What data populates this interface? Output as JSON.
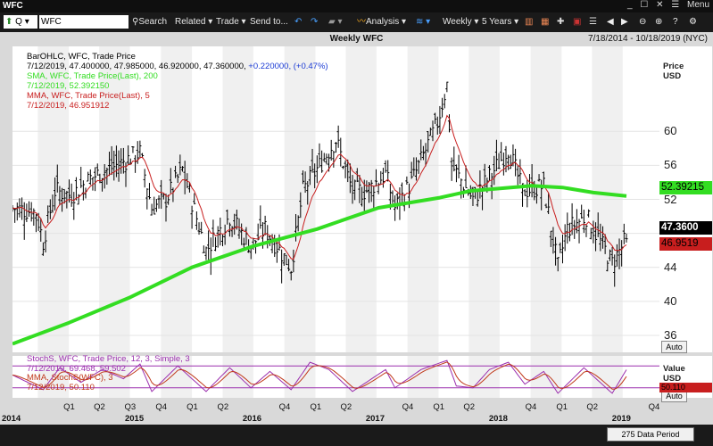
{
  "window": {
    "title": "WFC",
    "controls": [
      "_",
      "☐",
      "✕"
    ],
    "menu_label": "Menu"
  },
  "toolbar": {
    "symbol_prefix": "Q",
    "symbol_value": "WFC",
    "search_label": "Search",
    "related_label": "Related",
    "trade_label": "Trade",
    "sendto_label": "Send to...",
    "analysis_label": "Analysis",
    "weekly_label": "Weekly",
    "years_label": "5 Years"
  },
  "header": {
    "title": "Weekly WFC",
    "date_range": "7/18/2014 - 10/18/2019 (NYC)"
  },
  "legend_main": [
    {
      "text": "BarOHLC, WFC, Trade Price",
      "color": "#000000"
    },
    {
      "text": "7/12/2019, 47.400000, 47.985000, 46.920000, 47.360000, +0.220000, (+0.47%)",
      "color": "#000000",
      "extra": "+0.220000, (+0.47%)",
      "extra_color": "#1a3ad4"
    },
    {
      "text": "SMA, WFC, Trade Price(Last), 200",
      "color": "#33dd22"
    },
    {
      "text": "7/12/2019, 52.392150",
      "color": "#33dd22"
    },
    {
      "text": "MMA, WFC, Trade Price(Last), 5",
      "color": "#c81e1e"
    },
    {
      "text": "7/12/2019, 46.951912",
      "color": "#c81e1e"
    }
  ],
  "legend_stoch": [
    {
      "text": "StochS, WFC, Trade Price, 12, 3, Simple, 3",
      "color": "#9b2fae"
    },
    {
      "text": "7/12/2019, 69.468, 59.502",
      "color": "#9b2fae"
    },
    {
      "text": "MMA, StochS(WFC), 3",
      "color": "#c0391b"
    },
    {
      "text": "7/12/2019, 50.110",
      "color": "#c0391b"
    }
  ],
  "price_axis": {
    "title_line1": "Price",
    "title_line2": "USD",
    "auto_label": "Auto"
  },
  "value_axis": {
    "title_line1": "Value",
    "title_line2": "USD",
    "auto_label": "Auto"
  },
  "price_boxes": {
    "sma": "52.39215",
    "last": "47.3600",
    "mma": "46.9519",
    "stoch": "50.110"
  },
  "colors": {
    "sma": "#33dd22",
    "mma": "#c81e1e",
    "bars": "#000000",
    "stoch": "#9b2fae",
    "stoch_mma": "#c0391b"
  },
  "chart_data": {
    "type": "line",
    "title": "Weekly WFC",
    "x_range": [
      "2014-07-18",
      "2019-10-18"
    ],
    "ylim": [
      34,
      70
    ],
    "y_ticks": [
      36,
      40,
      44,
      48,
      52,
      56,
      60
    ],
    "y_tick_labels": [
      "36",
      "40",
      "44",
      "48",
      "52",
      "56",
      "60"
    ],
    "x_labels": [
      {
        "label": "2014",
        "d": "2014-07-18"
      },
      {
        "label": "Q1",
        "d": "2015-01-01"
      },
      {
        "label": "Q2",
        "d": "2015-04-01"
      },
      {
        "label": "Q3",
        "d": "2015-07-01"
      },
      {
        "label": "2015",
        "d": "2015-07-18"
      },
      {
        "label": "Q4",
        "d": "2015-10-01"
      },
      {
        "label": "Q1",
        "d": "2016-01-01"
      },
      {
        "label": "Q2",
        "d": "2016-04-01"
      },
      {
        "label": "2016",
        "d": "2016-07-01"
      },
      {
        "label": "Q4",
        "d": "2016-10-01"
      },
      {
        "label": "Q1",
        "d": "2017-01-01"
      },
      {
        "label": "Q2",
        "d": "2017-04-01"
      },
      {
        "label": "2017",
        "d": "2017-07-01"
      },
      {
        "label": "Q4",
        "d": "2017-10-01"
      },
      {
        "label": "Q1",
        "d": "2018-01-01"
      },
      {
        "label": "Q2",
        "d": "2018-04-01"
      },
      {
        "label": "2018",
        "d": "2018-07-01"
      },
      {
        "label": "Q4",
        "d": "2018-10-01"
      },
      {
        "label": "Q1",
        "d": "2019-01-01"
      },
      {
        "label": "Q2",
        "d": "2019-04-01"
      },
      {
        "label": "2019",
        "d": "2019-07-01"
      },
      {
        "label": "Q4",
        "d": "2019-10-01"
      }
    ],
    "close_keypoints": [
      {
        "d": "2014-07-18",
        "v": 51
      },
      {
        "d": "2014-09-26",
        "v": 50.5
      },
      {
        "d": "2014-10-17",
        "v": 47
      },
      {
        "d": "2014-11-21",
        "v": 53
      },
      {
        "d": "2015-01-09",
        "v": 52.5
      },
      {
        "d": "2015-03-06",
        "v": 54.5
      },
      {
        "d": "2015-05-22",
        "v": 56
      },
      {
        "d": "2015-07-31",
        "v": 57.5
      },
      {
        "d": "2015-09-04",
        "v": 51
      },
      {
        "d": "2015-10-16",
        "v": 52
      },
      {
        "d": "2015-12-04",
        "v": 55.5
      },
      {
        "d": "2016-02-12",
        "v": 46
      },
      {
        "d": "2016-04-22",
        "v": 50
      },
      {
        "d": "2016-06-24",
        "v": 46.5
      },
      {
        "d": "2016-08-05",
        "v": 48.5
      },
      {
        "d": "2016-10-21",
        "v": 44
      },
      {
        "d": "2016-11-25",
        "v": 53
      },
      {
        "d": "2017-03-03",
        "v": 59
      },
      {
        "d": "2017-04-21",
        "v": 53
      },
      {
        "d": "2017-06-02",
        "v": 53
      },
      {
        "d": "2017-07-28",
        "v": 55
      },
      {
        "d": "2017-08-25",
        "v": 51
      },
      {
        "d": "2017-10-13",
        "v": 54
      },
      {
        "d": "2017-12-29",
        "v": 61
      },
      {
        "d": "2018-01-26",
        "v": 65.5
      },
      {
        "d": "2018-02-09",
        "v": 56
      },
      {
        "d": "2018-04-13",
        "v": 52
      },
      {
        "d": "2018-06-08",
        "v": 55
      },
      {
        "d": "2018-07-27",
        "v": 58
      },
      {
        "d": "2018-09-07",
        "v": 53
      },
      {
        "d": "2018-11-09",
        "v": 53.5
      },
      {
        "d": "2018-12-21",
        "v": 44
      },
      {
        "d": "2019-01-18",
        "v": 48.5
      },
      {
        "d": "2019-03-15",
        "v": 50
      },
      {
        "d": "2019-05-31",
        "v": 44.5
      },
      {
        "d": "2019-07-12",
        "v": 47.36
      }
    ],
    "sma200": [
      {
        "d": "2014-07-18",
        "v": 35
      },
      {
        "d": "2015-01-02",
        "v": 37.5
      },
      {
        "d": "2015-07-03",
        "v": 40.5
      },
      {
        "d": "2016-01-01",
        "v": 44
      },
      {
        "d": "2016-07-01",
        "v": 46.5
      },
      {
        "d": "2017-01-06",
        "v": 48.5
      },
      {
        "d": "2017-07-07",
        "v": 51
      },
      {
        "d": "2018-01-05",
        "v": 52.2
      },
      {
        "d": "2018-04-06",
        "v": 53
      },
      {
        "d": "2018-10-05",
        "v": 53.6
      },
      {
        "d": "2019-01-04",
        "v": 53.4
      },
      {
        "d": "2019-04-05",
        "v": 52.8
      },
      {
        "d": "2019-07-12",
        "v": 52.39
      }
    ],
    "last": {
      "open": 47.4,
      "high": 47.985,
      "low": 46.92,
      "close": 47.36,
      "change": 0.22,
      "change_pct": 0.47
    },
    "sma_last": 52.39215,
    "mma_last": 46.951912
  },
  "stoch_data": {
    "ylim": [
      0,
      100
    ],
    "bands": [
      80,
      20
    ],
    "stoch_last": 69.468,
    "signal_last": 59.502,
    "mma_last": 50.11,
    "curve_keypoints": [
      {
        "d": "2014-07-18",
        "v": 55
      },
      {
        "d": "2014-10-17",
        "v": 15
      },
      {
        "d": "2014-12-05",
        "v": 75
      },
      {
        "d": "2015-02-06",
        "v": 35
      },
      {
        "d": "2015-04-10",
        "v": 70
      },
      {
        "d": "2015-06-12",
        "v": 45
      },
      {
        "d": "2015-07-31",
        "v": 85
      },
      {
        "d": "2015-09-04",
        "v": 10
      },
      {
        "d": "2015-11-20",
        "v": 80
      },
      {
        "d": "2016-02-12",
        "v": 10
      },
      {
        "d": "2016-04-22",
        "v": 75
      },
      {
        "d": "2016-06-24",
        "v": 20
      },
      {
        "d": "2016-08-19",
        "v": 65
      },
      {
        "d": "2016-10-21",
        "v": 15
      },
      {
        "d": "2016-12-16",
        "v": 90
      },
      {
        "d": "2017-02-10",
        "v": 70
      },
      {
        "d": "2017-04-21",
        "v": 10
      },
      {
        "d": "2017-07-28",
        "v": 70
      },
      {
        "d": "2017-08-25",
        "v": 20
      },
      {
        "d": "2017-11-10",
        "v": 70
      },
      {
        "d": "2018-01-26",
        "v": 95
      },
      {
        "d": "2018-02-23",
        "v": 25
      },
      {
        "d": "2018-04-13",
        "v": 20
      },
      {
        "d": "2018-06-01",
        "v": 70
      },
      {
        "d": "2018-07-27",
        "v": 90
      },
      {
        "d": "2018-09-14",
        "v": 30
      },
      {
        "d": "2018-11-09",
        "v": 65
      },
      {
        "d": "2018-12-21",
        "v": 5
      },
      {
        "d": "2019-03-08",
        "v": 75
      },
      {
        "d": "2019-05-31",
        "v": 5
      },
      {
        "d": "2019-07-12",
        "v": 69.5
      }
    ]
  },
  "status": {
    "data_period": "275 Data Period"
  }
}
